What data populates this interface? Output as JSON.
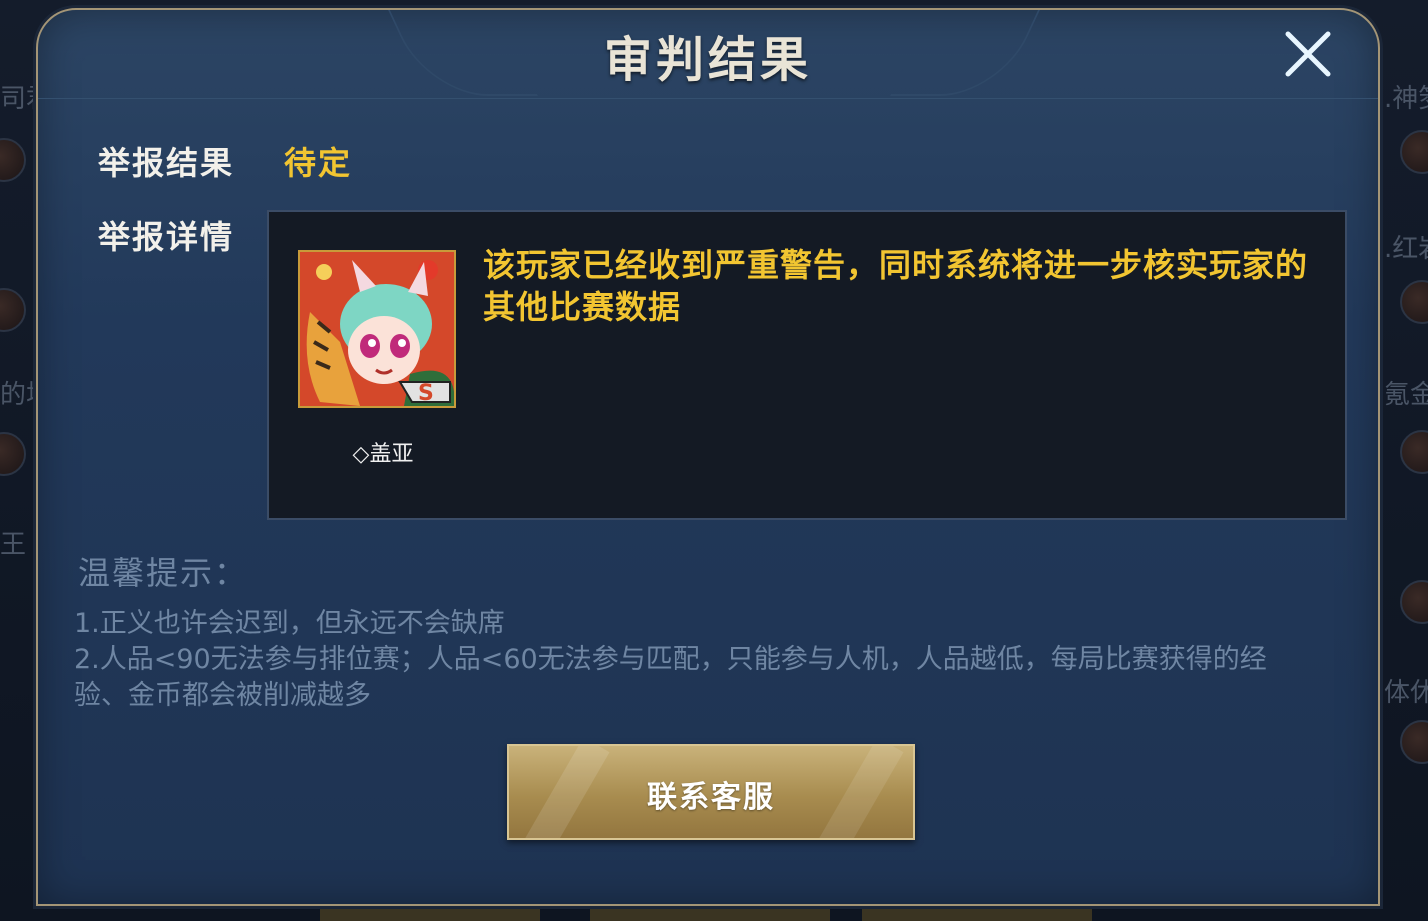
{
  "dialog": {
    "title": "审判结果",
    "close_icon": "close-icon"
  },
  "report": {
    "result_label": "举报结果",
    "result_value": "待定",
    "detail_label": "举报详情",
    "player": {
      "name": "◇盖亚",
      "avatar_icon": "player-avatar"
    },
    "message": "该玩家已经收到严重警告，同时系统将进一步核实玩家的其他比赛数据"
  },
  "tips": {
    "title": "温馨提示：",
    "lines": [
      "1.正义也许会迟到，但永远不会缺席",
      "2.人品<90无法参与排位赛；人品<60无法参与匹配，只能参与人机，人品越低，每局比赛获得的经",
      "验、金币都会被削减越多"
    ]
  },
  "actions": {
    "contact_label": "联系客服"
  },
  "colors": {
    "accent_gold": "#f2c531",
    "dialog_bg": "#22395a",
    "button_gold": "#a88c4f",
    "tip_text": "#6f86a3"
  }
}
